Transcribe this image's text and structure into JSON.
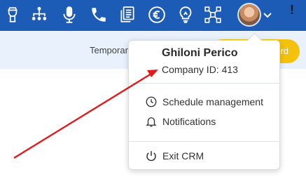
{
  "topbar": {
    "background": "#1c5bb6",
    "icons": [
      "building-icon",
      "org-chart-icon",
      "microphone-icon",
      "phone-icon",
      "documents-icon",
      "euro-icon",
      "lightbulb-icon",
      "network-icon"
    ],
    "avatar": "user-avatar",
    "alert_badge": "!"
  },
  "notice": {
    "text": "Temporar",
    "button_label": "rd",
    "button_color": "#f5c20b"
  },
  "user_menu": {
    "name": "Ghiloni Perico",
    "company_id": "Company ID: 413",
    "items": [
      {
        "label": "Schedule management",
        "icon": "clock-icon"
      },
      {
        "label": "Notifications",
        "icon": "bell-icon"
      },
      {
        "label": "Exit CRM",
        "icon": "power-icon"
      }
    ]
  },
  "annotation": {
    "arrow_color": "#e3191b"
  }
}
